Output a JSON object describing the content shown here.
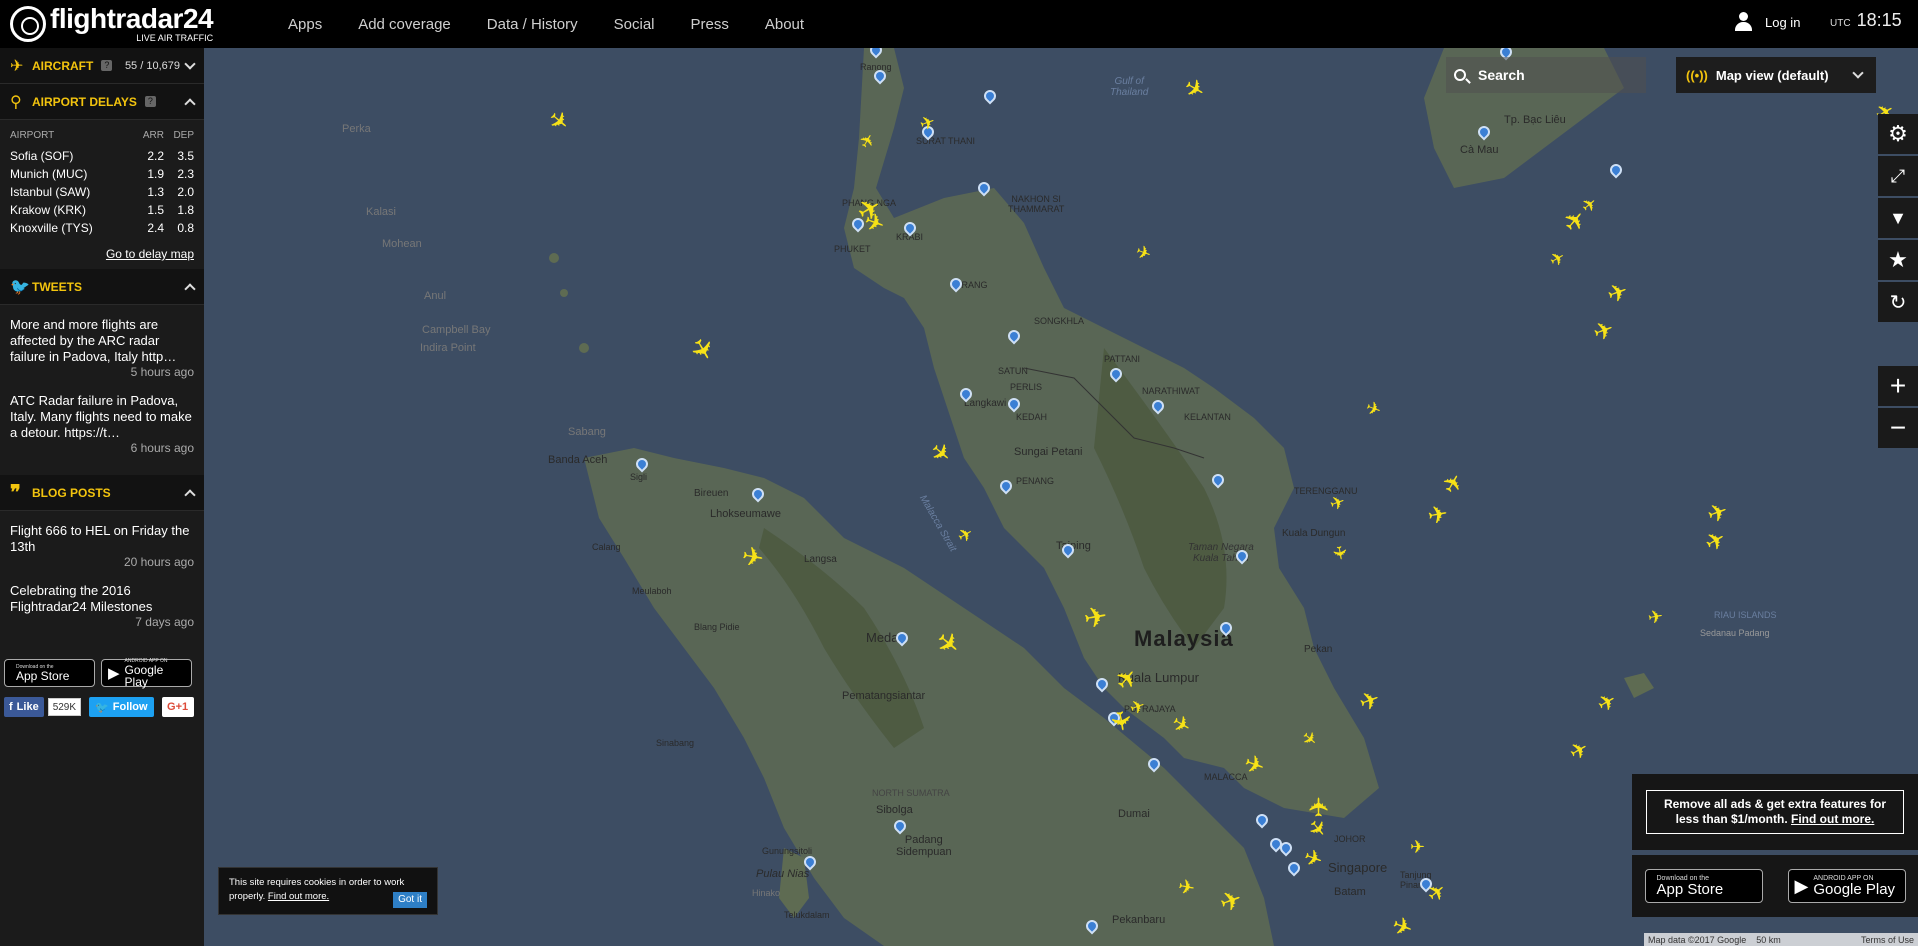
{
  "brand": {
    "name": "flightradar24",
    "tagline": "LIVE AIR TRAFFIC"
  },
  "nav": [
    "Apps",
    "Add coverage",
    "Data / History",
    "Social",
    "Press",
    "About"
  ],
  "header": {
    "login_label": "Log in",
    "utc_label": "UTC",
    "time": "18:15"
  },
  "sidebar": {
    "aircraft": {
      "label": "AIRCRAFT",
      "help": "?",
      "count": "55 / 10,679"
    },
    "delays": {
      "label": "AIRPORT DELAYS",
      "help": "?",
      "col_airport": "AIRPORT",
      "col_arr": "ARR",
      "col_dep": "DEP",
      "rows": [
        {
          "airport": "Sofia (SOF)",
          "arr": "2.2",
          "dep": "3.5"
        },
        {
          "airport": "Munich (MUC)",
          "arr": "1.9",
          "dep": "2.3"
        },
        {
          "airport": "Istanbul (SAW)",
          "arr": "1.3",
          "dep": "2.0"
        },
        {
          "airport": "Krakow (KRK)",
          "arr": "1.5",
          "dep": "1.8"
        },
        {
          "airport": "Knoxville (TYS)",
          "arr": "2.4",
          "dep": "0.8"
        }
      ],
      "link": "Go to delay map"
    },
    "tweets": {
      "label": "TWEETS",
      "items": [
        {
          "text": "More and more flights are affected by the ARC radar failure in Padova, Italy http…",
          "ago": "5 hours ago"
        },
        {
          "text": "ATC Radar failure in Padova, Italy. Many flights need to make a detour. https://t…",
          "ago": "6 hours ago"
        }
      ]
    },
    "blog": {
      "label": "BLOG POSTS",
      "items": [
        {
          "text": "Flight 666 to HEL on Friday the 13th",
          "ago": "20 hours ago"
        },
        {
          "text": "Celebrating the 2016 Flightradar24 Milestones",
          "ago": "7 days ago"
        }
      ]
    },
    "stores": {
      "appstore_small": "Download on the",
      "appstore": "App Store",
      "google_small": "ANDROID APP ON",
      "google": "Google Play"
    },
    "social": {
      "like": "Like",
      "like_count": "529K",
      "follow": "Follow",
      "gplus": "G+1"
    }
  },
  "map": {
    "search_placeholder": "Search",
    "view_label": "Map view (default)",
    "labels": {
      "gulf": "Gulf of\nThailand",
      "malaysia": "Malaysia",
      "malacca_strait": "Malacca Strait",
      "perka": "Perka",
      "kalasi": "Kalasi",
      "mohean": "Mohean",
      "anul": "Anul",
      "campbell": "Campbell Bay",
      "indira": "Indira Point",
      "sabang": "Sabang",
      "banda_aceh": "Banda Aceh",
      "sigli": "Sigli",
      "bireuen": "Bireuen",
      "lhokseumawe": "Lhokseumawe",
      "calang": "Calang",
      "langsa": "Langsa",
      "meulaboh": "Meulaboh",
      "blang_pidie": "Blang Pidie",
      "medan": "Medan",
      "pematang": "Pematangsiantar",
      "sinabang": "Sinabang",
      "sumatra_utara": "NORTH SUMATRA",
      "sibolga": "Sibolga",
      "padang_sid": "Padang\nSidempuan",
      "gunungsitoli": "Gunungsitoli",
      "pulau_nias": "Pulau Nias",
      "hinako": "Hinako",
      "teluk_dalam": "Telukdalam",
      "ranong": "Ranong",
      "surat_thani": "SURAT THANI",
      "phang_nga": "PHANG NGA",
      "phuket": "PHUKET",
      "krabi": "KRABI",
      "nakhon": "NAKHON SI\nTHAMMARAT",
      "trang": "TRANG",
      "songkhla": "SONGKHLA",
      "satun": "SATUN",
      "pattani": "PATTANI",
      "narathiwat": "NARATHIWAT",
      "langkawi": "Langkawi",
      "perlis": "PERLIS",
      "kedah": "KEDAH",
      "kelantan": "KELANTAN",
      "sungai_petani": "Sungai Petani",
      "penang": "PENANG",
      "terengganu": "TERENGGANU",
      "kuala_dungun": "Kuala Dungun",
      "taiping": "Taiping",
      "taman_negara": "Taman Negara\nKuala Tahan",
      "kuala_lumpur": "Kuala Lumpur",
      "putrajaya": "PUTRAJAYA",
      "pekan": "Pekan",
      "malacca": "MALACCA",
      "dumai": "Dumai",
      "johor": "JOHOR",
      "singapore": "Singapore",
      "batam": "Batam",
      "tanjung": "Tanjung\nPinang",
      "pekanbaru": "Pekanbaru",
      "ca_mau": "Cà Mau",
      "bac_lieu": "Tp. Bạc Liêu",
      "riau_islands": "RIAU ISLANDS",
      "sedanau": "Sedanau  Padang"
    },
    "promo": {
      "text": "Remove all ads & get extra features for less than $1/month.",
      "link": "Find out more."
    },
    "cookie": {
      "text": "This site requires cookies in order to work properly.",
      "link": "Find out more.",
      "button": "Got it"
    },
    "footer": {
      "copyright": "Map data ©2017 Google",
      "scale": "50 km",
      "terms": "Terms of Use"
    }
  }
}
